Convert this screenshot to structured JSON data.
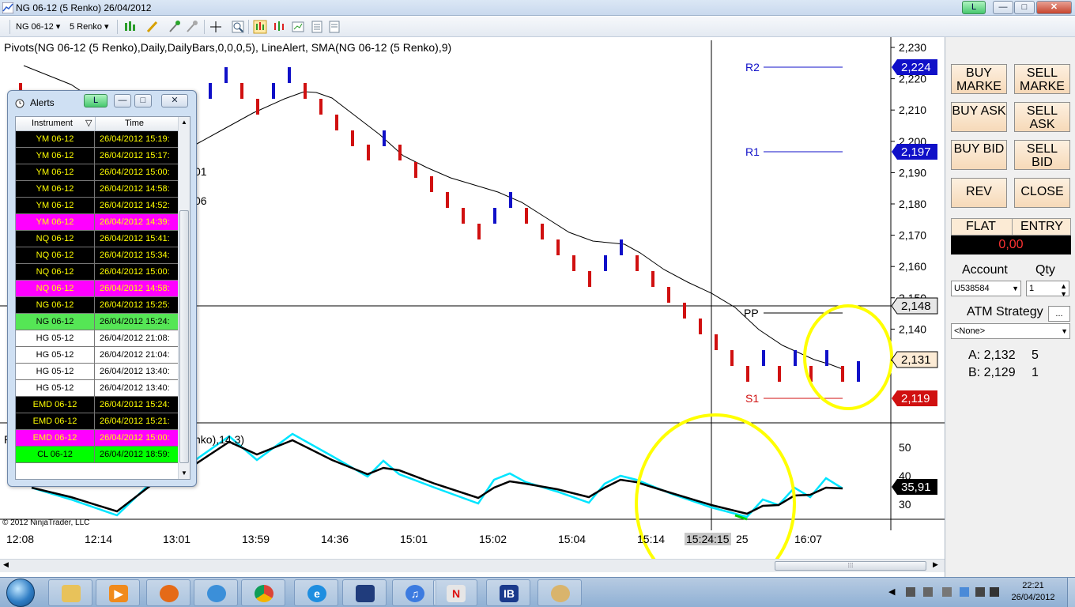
{
  "window": {
    "title": "NG 06-12 (5 Renko)  26/04/2012",
    "l_label": "L",
    "min_label": "—",
    "max_label": "□",
    "close_label": "✕"
  },
  "toolbar": {
    "instrument": "NG 06-12",
    "period": "5 Renko"
  },
  "chart": {
    "indicator_title": "Pivots(NG 06-12 (5 Renko),Daily,DailyBars,0,0,0,5), LineAlert, SMA(NG 06-12 (5 Renko),9)",
    "lower_panel_title_left": "R",
    "lower_panel_title_right": "nko),14,3)",
    "hidden_label_1": "01",
    "hidden_label_2": "06",
    "copyright": "© 2012 NinjaTrader, LLC",
    "pivots": {
      "R2": {
        "label": "R2",
        "value": "2,224"
      },
      "R1": {
        "label": "R1",
        "value": "2,197"
      },
      "PP": {
        "label": "PP",
        "value": "2,148"
      },
      "S1": {
        "label": "S1",
        "value": "2,119"
      }
    },
    "last_price": "2,131",
    "lower_value": "35,91",
    "price_axis": [
      "2,230",
      "2,220",
      "2,210",
      "2,200",
      "2,190",
      "2,180",
      "2,170",
      "2,160",
      "2,150",
      "2,140",
      "2,130"
    ],
    "lower_axis": [
      "50",
      "40",
      "30"
    ],
    "time_axis": [
      "12:08",
      "12:14",
      "13:01",
      "13:59",
      "14:36",
      "15:01",
      "15:02",
      "15:04",
      "15:14",
      "15:24:15",
      "16:07"
    ],
    "crosshair_time": "15:24:15",
    "crosshair_time_suffix": "25",
    "colors": {
      "up_brick": "#1010c8",
      "down_brick": "#d01010",
      "sma": "#000000",
      "stoch_k": "#00e5ff",
      "stoch_d": "#000000",
      "highlight": "#ffff00"
    }
  },
  "alerts": {
    "title": "Alerts",
    "l_label": "L",
    "columns": [
      "Instrument",
      "Time"
    ],
    "rows": [
      {
        "instrument": "YM 06-12",
        "time": "26/04/2012 15:19:",
        "style": "black"
      },
      {
        "instrument": "YM 06-12",
        "time": "26/04/2012 15:17:",
        "style": "black"
      },
      {
        "instrument": "YM 06-12",
        "time": "26/04/2012 15:00:",
        "style": "black"
      },
      {
        "instrument": "YM 06-12",
        "time": "26/04/2012 14:58:",
        "style": "black"
      },
      {
        "instrument": "YM 06-12",
        "time": "26/04/2012 14:52:",
        "style": "black"
      },
      {
        "instrument": "YM 06-12",
        "time": "26/04/2012 14:39:",
        "style": "magenta"
      },
      {
        "instrument": "NQ 06-12",
        "time": "26/04/2012 15:41:",
        "style": "black"
      },
      {
        "instrument": "NQ 06-12",
        "time": "26/04/2012 15:34:",
        "style": "black"
      },
      {
        "instrument": "NQ 06-12",
        "time": "26/04/2012 15:00:",
        "style": "black"
      },
      {
        "instrument": "NQ 06-12",
        "time": "26/04/2012 14:58:",
        "style": "magenta"
      },
      {
        "instrument": "NG 06-12",
        "time": "26/04/2012 15:25:",
        "style": "black"
      },
      {
        "instrument": "NG 06-12",
        "time": "26/04/2012 15:24:",
        "style": "green"
      },
      {
        "instrument": "HG 05-12",
        "time": "26/04/2012 21:08:",
        "style": "white"
      },
      {
        "instrument": "HG 05-12",
        "time": "26/04/2012 21:04:",
        "style": "white"
      },
      {
        "instrument": "HG 05-12",
        "time": "26/04/2012 13:40:",
        "style": "white"
      },
      {
        "instrument": "HG 05-12",
        "time": "26/04/2012 13:40:",
        "style": "white"
      },
      {
        "instrument": "EMD 06-12",
        "time": "26/04/2012 15:24:",
        "style": "black"
      },
      {
        "instrument": "EMD 06-12",
        "time": "26/04/2012 15:21:",
        "style": "black"
      },
      {
        "instrument": "EMD 06-12",
        "time": "26/04/2012 15:00:",
        "style": "magenta"
      },
      {
        "instrument": "CL 06-12",
        "time": "26/04/2012 18:59:",
        "style": "lime"
      }
    ]
  },
  "order_panel": {
    "buy_market": "BUY MARKE",
    "sell_market": "SELL MARKE",
    "buy_ask": "BUY ASK",
    "sell_ask": "SELL ASK",
    "buy_bid": "BUY BID",
    "sell_bid": "SELL BID",
    "rev": "REV",
    "close": "CLOSE",
    "position": "FLAT",
    "entry": "ENTRY",
    "pnl": "0,00",
    "account_label": "Account",
    "qty_label": "Qty",
    "account_value": "U538584",
    "qty_value": "1",
    "atm_label": "ATM Strategy",
    "atm_btn": "...",
    "atm_value": "<None>",
    "ask_label": "A: 2,132",
    "ask_size": "5",
    "bid_label": "B: 2,129",
    "bid_size": "1"
  },
  "taskbar": {
    "time": "22:21",
    "date": "26/04/2012",
    "ib_label": "IB"
  }
}
